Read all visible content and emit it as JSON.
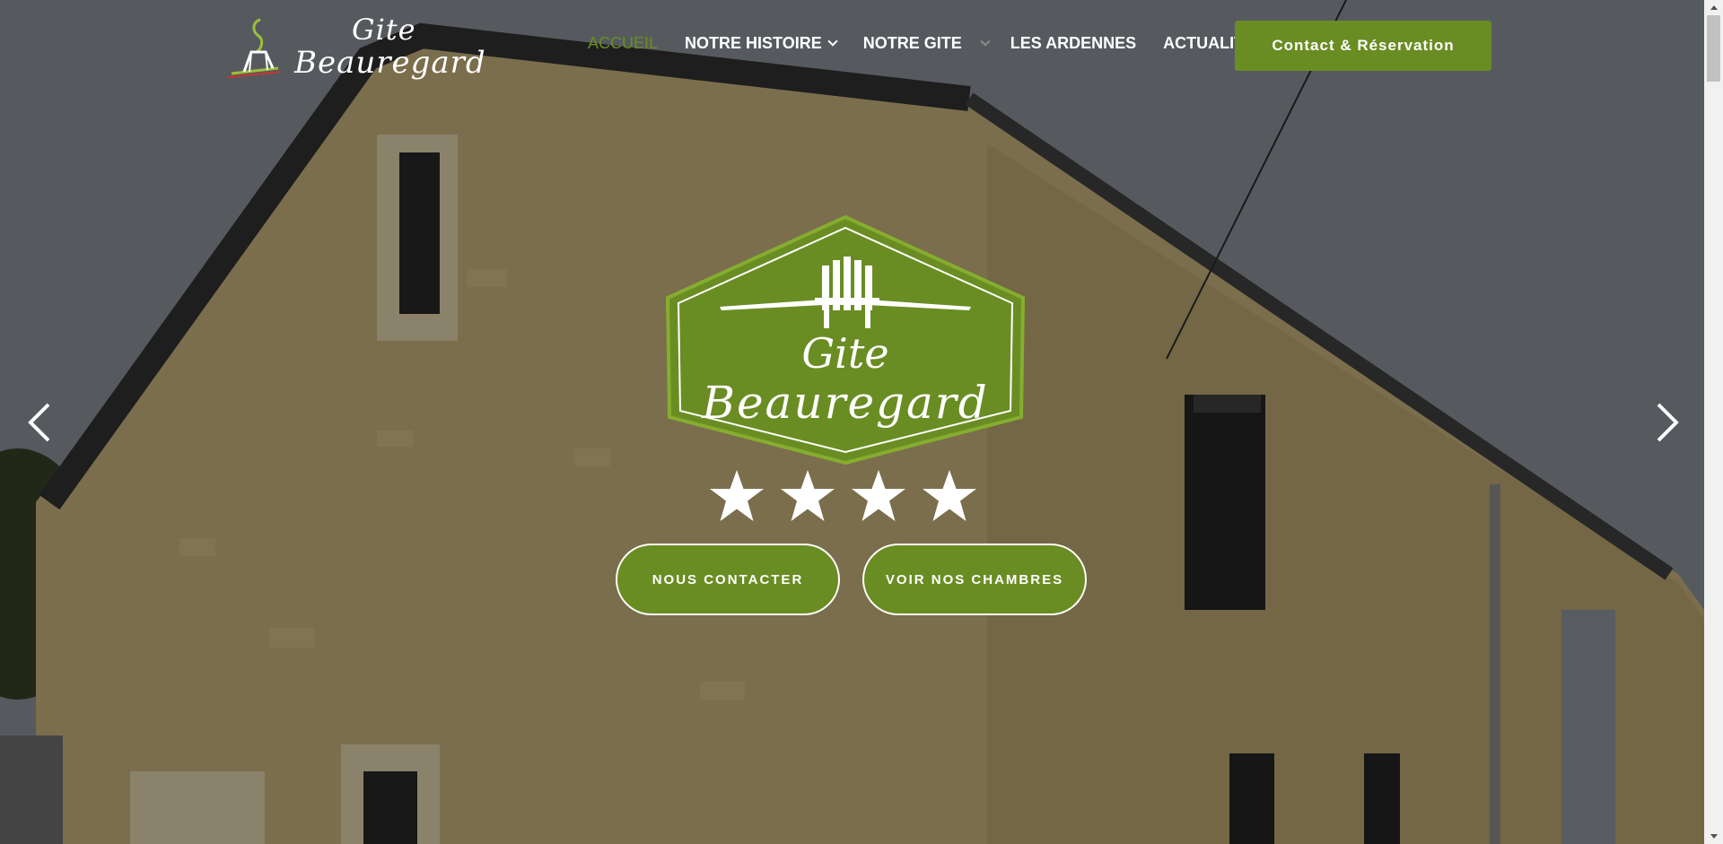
{
  "header": {
    "logo_line1": "Gite",
    "logo_line2": "Beauregard",
    "nav": [
      {
        "label": "ACCUEIL",
        "active": true,
        "has_dropdown": false
      },
      {
        "label": "NOTRE HISTOIRE",
        "active": false,
        "has_dropdown": true
      },
      {
        "label": "NOTRE GITE",
        "active": false,
        "has_dropdown": true
      },
      {
        "label": "LES ARDENNES",
        "active": false,
        "has_dropdown": false
      },
      {
        "label": "ACTUALITÉS",
        "active": false,
        "has_dropdown": false
      }
    ],
    "cta_label": "Contact & Réservation"
  },
  "hero": {
    "badge_line1": "Gite",
    "badge_line2": "Beauregard",
    "star_count": 4,
    "buttons": {
      "contact_label": "NOUS CONTACTER",
      "rooms_label": "VOIR NOS CHAMBRES"
    },
    "icons": {
      "prev": "chevron-left-icon",
      "next": "chevron-right-icon"
    }
  },
  "colors": {
    "brand_green": "#6a8d23",
    "text_white": "#ffffff"
  }
}
